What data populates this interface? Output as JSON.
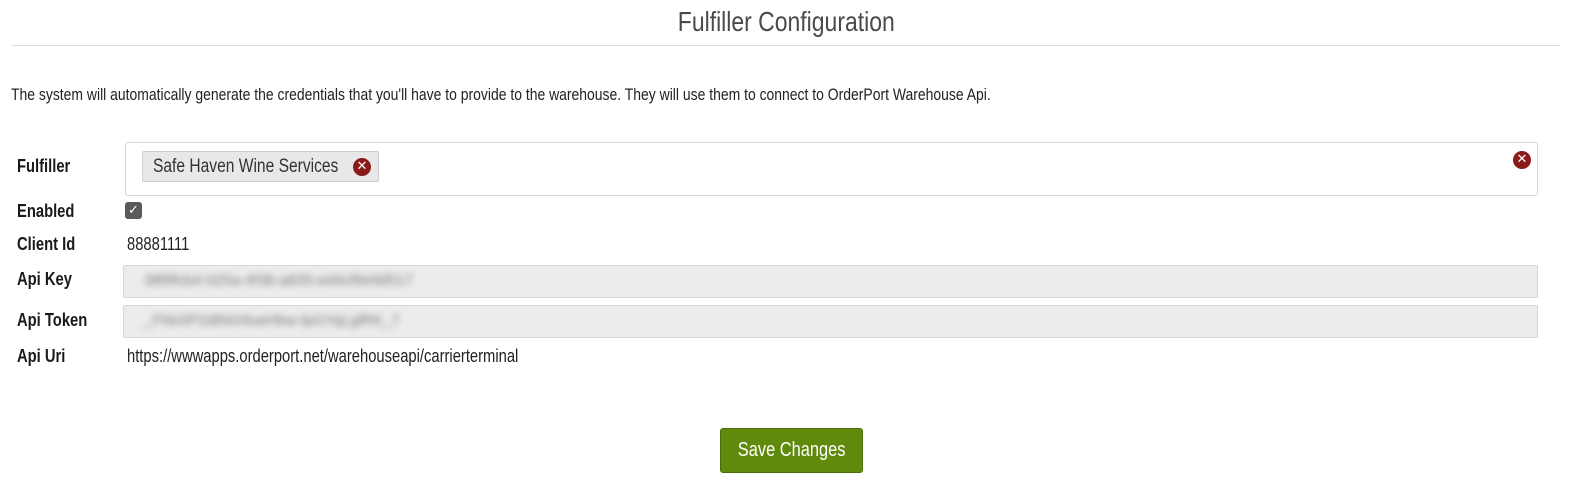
{
  "page": {
    "title": "Fulfiller Configuration",
    "intro": "The system will automatically generate the credentials that you'll have to provide to the warehouse. They will use them to connect to OrderPort Warehouse Api."
  },
  "form": {
    "fulfiller": {
      "label": "Fulfiller",
      "selected_tag": "Safe Haven Wine Services",
      "remove_icon": "x-circle-icon",
      "clear_icon": "x-circle-icon"
    },
    "enabled": {
      "label": "Enabled",
      "checked": true
    },
    "client_id": {
      "label": "Client Id",
      "value": "88881111"
    },
    "api_key": {
      "label": "Api Key",
      "value": "38f9fcb4-025a-4f38-a835-ed4cf9e9d517"
    },
    "api_token": {
      "label": "Api Token",
      "value": "_FhbSP2dtNG9ueHbw-lpGYqLglRK_7"
    },
    "api_uri": {
      "label": "Api Uri",
      "value": "https://wwwapps.orderport.net/warehouseapi/carrierterminal"
    }
  },
  "actions": {
    "save_label": "Save Changes"
  },
  "colors": {
    "save_button": "#5f8a0b",
    "remove_icon": "#8b1a1a",
    "readonly_field": "#ececec"
  }
}
